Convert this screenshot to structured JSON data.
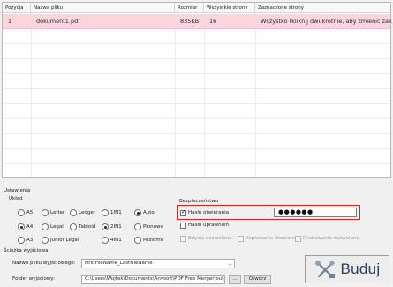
{
  "table": {
    "headers": [
      "Pozycja",
      "Nazwa pliku",
      "Rozmiar",
      "Wszystkie strony",
      "Zaznaczone strony"
    ],
    "rows": [
      {
        "position": "1",
        "filename": "dokument1.pdf",
        "size": "835KB",
        "pages": "16",
        "selected_pages": "Wszystko (kliknij dwukrotnie, aby zmienić zakre..."
      }
    ]
  },
  "settings": {
    "title": "Ustawienia",
    "layout_label": "Układ",
    "page_sizes": [
      "A5",
      "A4",
      "A3"
    ],
    "paper_types": [
      "Letter",
      "Legal",
      "Junior Legal"
    ],
    "ledger": "Ledger",
    "tabloid": "Tabloid",
    "nup": [
      "1IN1",
      "2IN1",
      "4IN1"
    ],
    "orientation": [
      "Auto",
      "Pionowo",
      "Poziomo"
    ],
    "selected": {
      "page_size": "A4",
      "nup": "2IN1",
      "orientation": "Auto"
    }
  },
  "security": {
    "title": "Bezpieczeństwo",
    "open_password_label": "Hasło otwierania",
    "open_password_checked": true,
    "password_value": "●●●●●●",
    "permissions_label": "Hasło uprawnień",
    "permissions_checked": false,
    "edit_allowed": "Edycja dozwolona",
    "copy_allowed": "Kopiowanie dozwolone",
    "print_allowed": "Drukowanie dozwolone"
  },
  "output": {
    "title": "Ścieżka wyjściowa:",
    "filename_label": "Nazwa pliku wyjściowego:",
    "filename_value": "FirstFileName_LastFileName",
    "folder_label": "Folder wyjściowy:",
    "folder_value": "C:\\Users\\Wojtek\\Documents\\Anvsoft\\PDF Free Merger\\output\\",
    "browse_label": "...",
    "open_label": "Otwórz"
  },
  "build": {
    "label": "Buduj"
  },
  "colors": {
    "selected_row": "#f9d6dd",
    "highlight": "#e02222",
    "build_text": "#2c3e5c"
  }
}
